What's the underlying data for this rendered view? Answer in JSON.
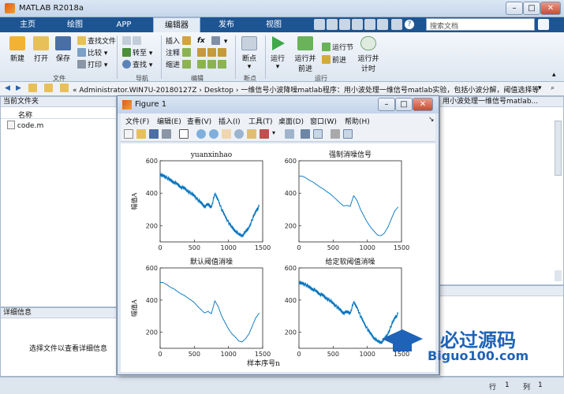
{
  "window": {
    "title": "MATLAB R2018a"
  },
  "tabs": [
    "主页",
    "绘图",
    "APP",
    "编辑器",
    "发布",
    "视图"
  ],
  "active_tab": "编辑器",
  "search": {
    "placeholder": "搜索文档"
  },
  "ribbon": {
    "file": {
      "new": "新建",
      "open": "打开",
      "save": "保存",
      "find_files": "查找文件",
      "compare": "比较",
      "print": "打印",
      "group": "文件"
    },
    "nav": {
      "goto": "转至",
      "find": "查找",
      "group": "导航"
    },
    "edit": {
      "insert": "插入",
      "comment": "注释",
      "indent": "缩进",
      "fx": "fx",
      "group": "编辑"
    },
    "breakpoints": {
      "label": "断点",
      "group": "断点"
    },
    "run": {
      "run": "运行",
      "run_advance": "运行并前进",
      "run_section": "运行节",
      "advance": "前进",
      "run_time": "运行并计时",
      "group": "运行"
    }
  },
  "address": {
    "path": "« Administrator.WIN7U-20180127Z  ›  Desktop  ›  一维信号小波降噪matlab程序：用小波处理一维信号matlab实验，包括小波分解，阈值选择等"
  },
  "current_folder": {
    "title": "当前文件夹",
    "col_name": "名称",
    "files": [
      "code.m"
    ]
  },
  "details": {
    "title": "详细信息",
    "message": "选择文件以查看详细信息"
  },
  "editor_title_partial": "用小波处理一维信号matlab...",
  "status": {
    "line_label": "行",
    "line": "1",
    "col_label": "列",
    "col": "1"
  },
  "figure": {
    "title": "Figure 1",
    "menu": [
      "文件(F)",
      "编辑(E)",
      "查看(V)",
      "插入(I)",
      "工具(T)",
      "桌面(D)",
      "窗口(W)",
      "帮助(H)"
    ]
  },
  "watermark": {
    "brand": "必过源码",
    "url": "Biguo100.com"
  },
  "chart_data": [
    {
      "type": "line",
      "title": "yuanxinhao",
      "xlabel": "",
      "ylabel": "幅值A",
      "xlim": [
        0,
        1500
      ],
      "ylim": [
        100,
        600
      ],
      "xticks": [
        0,
        500,
        1000,
        1500
      ],
      "yticks": [
        200,
        400,
        600
      ],
      "noisy": true,
      "x": [
        0,
        50,
        100,
        150,
        200,
        250,
        300,
        350,
        400,
        450,
        500,
        550,
        600,
        650,
        700,
        750,
        800,
        850,
        900,
        950,
        1000,
        1050,
        1100,
        1150,
        1200,
        1250,
        1300,
        1350,
        1400,
        1450
      ],
      "y": [
        510,
        508,
        495,
        480,
        470,
        455,
        440,
        430,
        415,
        400,
        385,
        360,
        340,
        320,
        330,
        315,
        395,
        360,
        300,
        260,
        220,
        190,
        170,
        145,
        140,
        160,
        190,
        240,
        290,
        320
      ]
    },
    {
      "type": "line",
      "title": "强制消噪信号",
      "xlabel": "",
      "ylabel": "",
      "xlim": [
        0,
        1500
      ],
      "ylim": [
        100,
        600
      ],
      "xticks": [
        0,
        500,
        1000,
        1500
      ],
      "yticks": [
        200,
        400,
        600
      ],
      "noisy": false,
      "x": [
        0,
        50,
        100,
        150,
        200,
        250,
        300,
        350,
        400,
        450,
        500,
        550,
        600,
        650,
        700,
        750,
        800,
        850,
        900,
        950,
        1000,
        1050,
        1100,
        1150,
        1200,
        1250,
        1300,
        1350,
        1400,
        1450
      ],
      "y": [
        505,
        505,
        495,
        480,
        470,
        455,
        440,
        428,
        412,
        398,
        380,
        360,
        340,
        322,
        325,
        320,
        385,
        355,
        300,
        260,
        220,
        190,
        165,
        142,
        138,
        155,
        190,
        240,
        290,
        315
      ]
    },
    {
      "type": "line",
      "title": "默认阈值消噪",
      "xlabel": "",
      "ylabel": "幅值A",
      "xlim": [
        0,
        1500
      ],
      "ylim": [
        100,
        600
      ],
      "xticks": [
        0,
        500,
        1000,
        1500
      ],
      "yticks": [
        200,
        400,
        600
      ],
      "noisy": false,
      "x": [
        0,
        50,
        100,
        150,
        200,
        250,
        300,
        350,
        400,
        450,
        500,
        550,
        600,
        650,
        700,
        750,
        800,
        850,
        900,
        950,
        1000,
        1050,
        1100,
        1150,
        1200,
        1250,
        1300,
        1350,
        1400,
        1450
      ],
      "y": [
        510,
        508,
        495,
        480,
        470,
        455,
        440,
        430,
        415,
        400,
        385,
        360,
        340,
        320,
        330,
        315,
        395,
        360,
        300,
        260,
        220,
        190,
        170,
        145,
        140,
        160,
        190,
        240,
        290,
        320
      ]
    },
    {
      "type": "line",
      "title": "给定软阈值消噪",
      "xlabel": "样本序号n",
      "ylabel": "",
      "xlim": [
        0,
        1500
      ],
      "ylim": [
        100,
        600
      ],
      "xticks": [
        0,
        500,
        1000,
        1500
      ],
      "yticks": [
        200,
        400,
        600
      ],
      "noisy": true,
      "x": [
        0,
        50,
        100,
        150,
        200,
        250,
        300,
        350,
        400,
        450,
        500,
        550,
        600,
        650,
        700,
        750,
        800,
        850,
        900,
        950,
        1000,
        1050,
        1100,
        1150,
        1200,
        1250,
        1300,
        1350,
        1400,
        1450
      ],
      "y": [
        505,
        505,
        495,
        480,
        470,
        455,
        440,
        428,
        412,
        398,
        380,
        360,
        340,
        322,
        325,
        320,
        385,
        355,
        300,
        260,
        220,
        190,
        165,
        142,
        138,
        155,
        190,
        240,
        290,
        315
      ]
    }
  ]
}
